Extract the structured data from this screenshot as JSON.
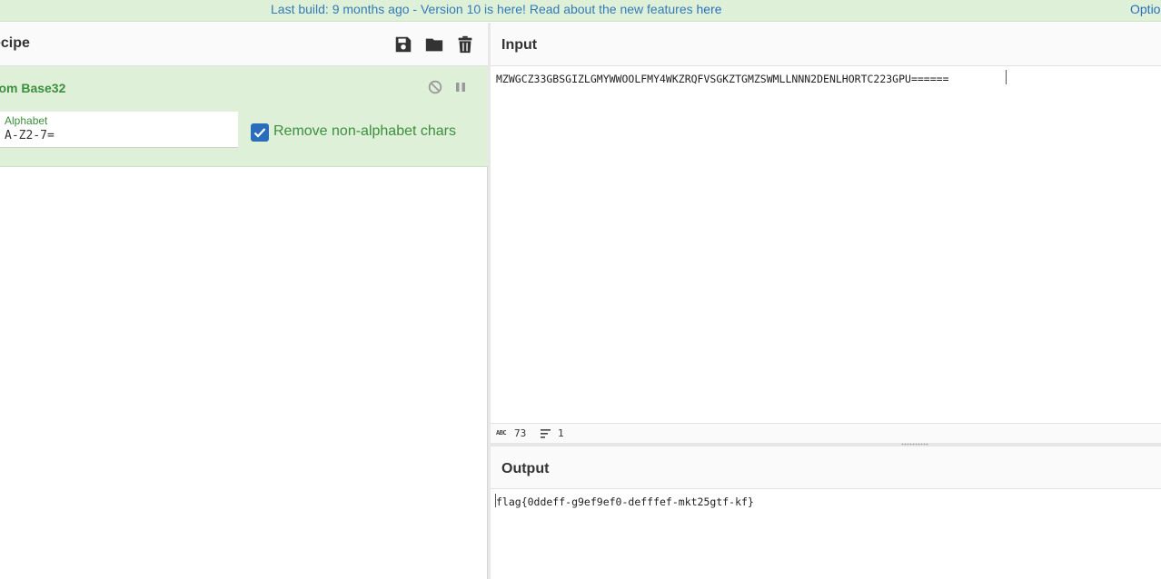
{
  "banner": {
    "prefix": "Last build: 9 months ago - Version 10 is here! Read about the new features ",
    "link": "here",
    "options": "Optio"
  },
  "recipe": {
    "title": "ecipe",
    "operation": {
      "title": "rom Base32",
      "alphabet_label": "Alphabet",
      "alphabet_value": "A-Z2-7=",
      "checkbox_label": "Remove non-alphabet chars",
      "checkbox_checked": true
    },
    "icons": [
      "save-icon",
      "folder-icon",
      "trash-icon"
    ]
  },
  "input": {
    "title": "Input",
    "text": "MZWGCZ33GBSGIZLGMYWWOOLFMY4WKZRQFVSGKZTGMZSWMLLNNN2DENLHORTC223GPU======",
    "length_label": "ABC",
    "length": "73",
    "lines": "1"
  },
  "output": {
    "title": "Output",
    "text": "flag{0ddeff-g9ef9ef0-defffef-mkt25gtf-kf}"
  },
  "colors": {
    "banner_bg": "#dff0d8",
    "link": "#2a6ebb",
    "operation_bg": "#dff0d8",
    "operation_text": "#3c8f3c",
    "checkbox": "#2a6ebb"
  }
}
